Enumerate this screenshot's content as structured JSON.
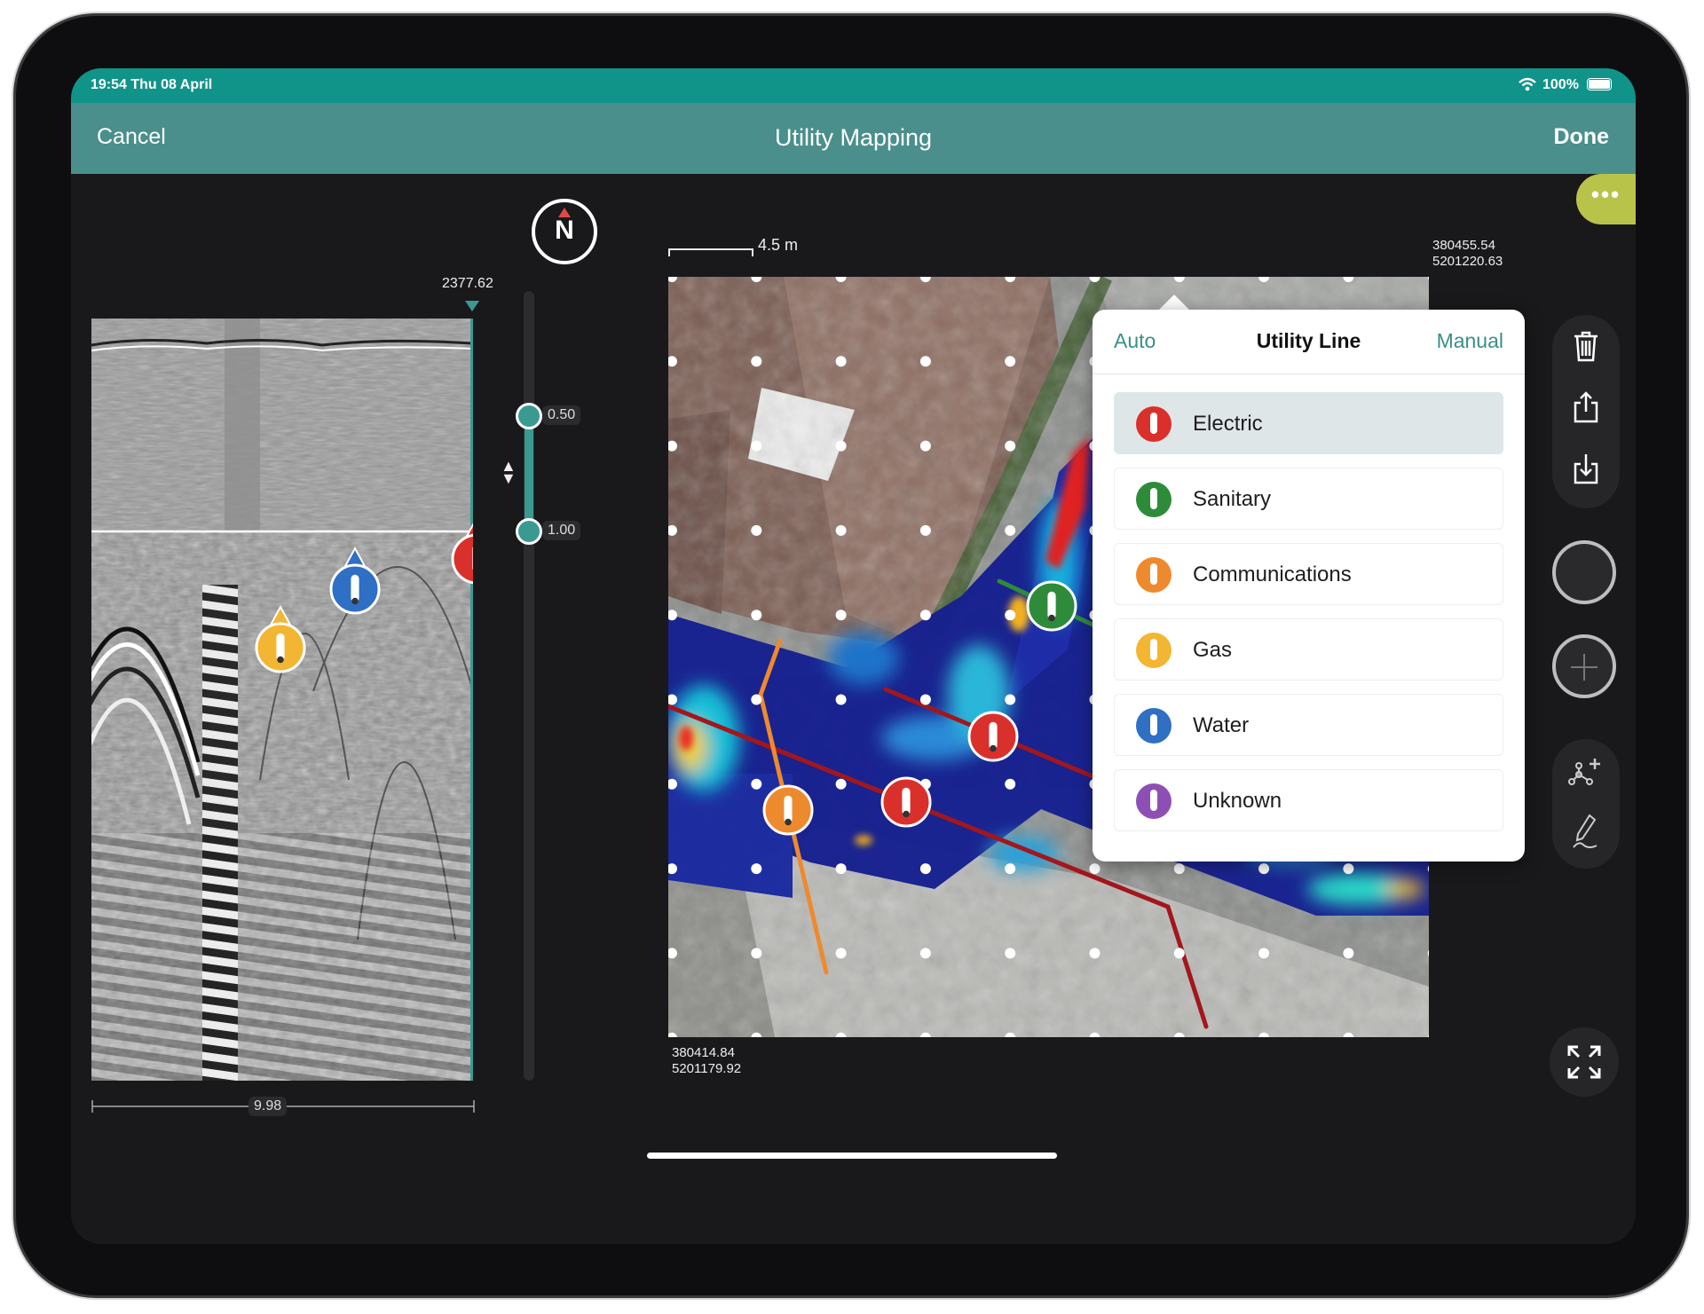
{
  "status_bar": {
    "time": "19:54 Thu 08 April",
    "battery": "100%",
    "wifi_icon": "wifi-icon",
    "battery_level": 1.0
  },
  "nav": {
    "cancel": "Cancel",
    "title": "Utility Mapping",
    "done": "Done"
  },
  "more_button": {
    "label": "•••"
  },
  "compass": {
    "label": "N"
  },
  "radargram": {
    "position_label": "2377.62",
    "width_label": "9.98",
    "markers": [
      "gas",
      "water",
      "electric"
    ]
  },
  "depth_slider": {
    "top_value": "0.50",
    "bottom_value": "1.00"
  },
  "map": {
    "scale_label": "4.5 m",
    "top_right_coord": {
      "x": "380455.54",
      "y": "5201220.63"
    },
    "bottom_left_coord": {
      "x": "380414.84",
      "y": "5201179.92"
    },
    "markers": [
      "sanitary",
      "electric",
      "electric",
      "communications"
    ]
  },
  "popover": {
    "tab_left": "Auto",
    "title": "Utility Line",
    "tab_right": "Manual",
    "selected": "Electric",
    "items": [
      {
        "label": "Electric",
        "color": "#d9302c"
      },
      {
        "label": "Sanitary",
        "color": "#2e8b3a"
      },
      {
        "label": "Communications",
        "color": "#ee8a2e"
      },
      {
        "label": "Gas",
        "color": "#f2b632"
      },
      {
        "label": "Water",
        "color": "#2f6fc4"
      },
      {
        "label": "Unknown",
        "color": "#8e4fb5"
      }
    ]
  },
  "colors": {
    "status_bar": "#10948a",
    "nav_bar": "#4a8f8c",
    "accent": "#3a9a92",
    "more_button": "#b8c34a",
    "electric": "#d9302c",
    "sanitary": "#2e8b3a",
    "communications": "#ee8a2e",
    "gas": "#f2b632",
    "water": "#2f6fc4",
    "unknown": "#8e4fb5"
  },
  "toolbar": {
    "icons": [
      "trash-icon",
      "share-icon",
      "download-icon",
      "record-button",
      "add-point-icon",
      "network-add-icon",
      "draw-pen-icon",
      "expand-icon"
    ]
  }
}
